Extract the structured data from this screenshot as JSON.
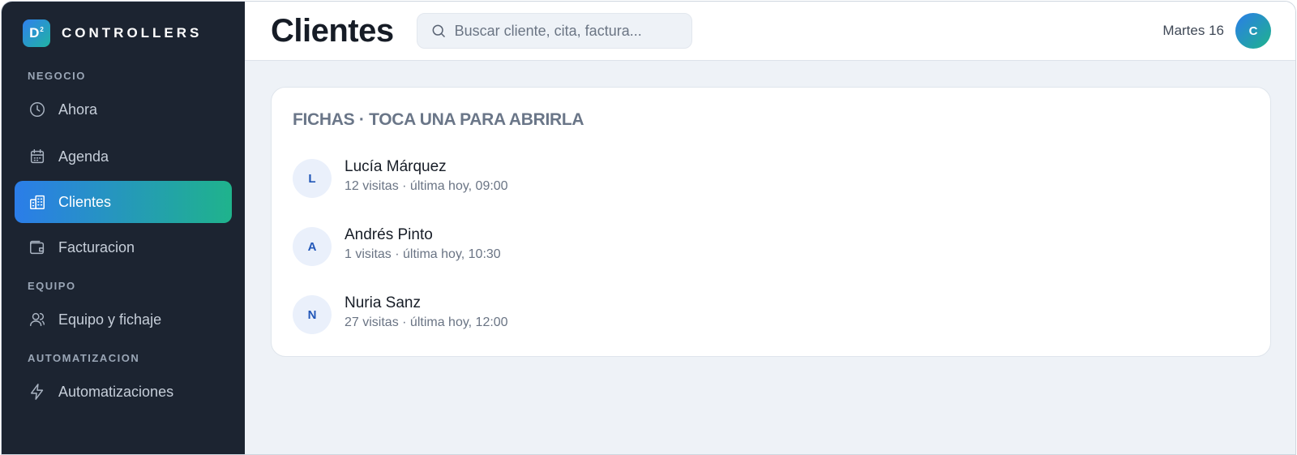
{
  "brand": {
    "logo_letter": "D",
    "logo_sup": "2",
    "name": "CONTROLLERS"
  },
  "sidebar": {
    "sections": [
      {
        "label": "NEGOCIO"
      },
      {
        "label": "EQUIPO"
      },
      {
        "label": "AUTOMATIZACION"
      }
    ],
    "items": [
      {
        "label": "Ahora",
        "icon": "clock-icon"
      },
      {
        "label": "Agenda",
        "icon": "calendar-icon"
      },
      {
        "label": "Clientes",
        "icon": "building-icon",
        "active": true
      },
      {
        "label": "Facturacion",
        "icon": "wallet-icon"
      },
      {
        "label": "Equipo y fichaje",
        "icon": "user-icon"
      },
      {
        "label": "Automatizaciones",
        "icon": "lightning-icon"
      }
    ]
  },
  "header": {
    "title": "Clientes",
    "search_placeholder": "Buscar cliente, cita, factura...",
    "date": "Martes 16",
    "avatar_initial": "C"
  },
  "card": {
    "title": "FICHAS · TOCA UNA PARA ABRIRLA",
    "clients": [
      {
        "initial": "L",
        "name": "Lucía Márquez",
        "meta": "12 visitas · última hoy, 09:00"
      },
      {
        "initial": "A",
        "name": "Andrés Pinto",
        "meta": "1 visitas · última hoy, 10:30"
      },
      {
        "initial": "N",
        "name": "Nuria Sanz",
        "meta": "27 visitas · última hoy, 12:00"
      }
    ]
  },
  "colors": {
    "sidebar_bg": "#1c2431",
    "accent_start": "#2b7de9",
    "accent_end": "#1fb38c",
    "main_bg": "#eef2f7"
  }
}
